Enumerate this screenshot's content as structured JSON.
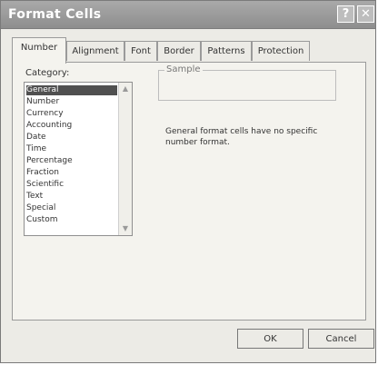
{
  "window": {
    "title": "Format Cells",
    "help_label": "?",
    "close_label": "✕"
  },
  "tabs": [
    {
      "label": "Number"
    },
    {
      "label": "Alignment"
    },
    {
      "label": "Font"
    },
    {
      "label": "Border"
    },
    {
      "label": "Patterns"
    },
    {
      "label": "Protection"
    }
  ],
  "category": {
    "label": "Category:",
    "items": [
      "General",
      "Number",
      "Currency",
      "Accounting",
      "Date",
      "Time",
      "Percentage",
      "Fraction",
      "Scientific",
      "Text",
      "Special",
      "Custom"
    ],
    "selected": "General"
  },
  "sample": {
    "label": "Sample",
    "value": ""
  },
  "description": "General format cells have no specific number format.",
  "buttons": {
    "ok": "OK",
    "cancel": "Cancel"
  }
}
